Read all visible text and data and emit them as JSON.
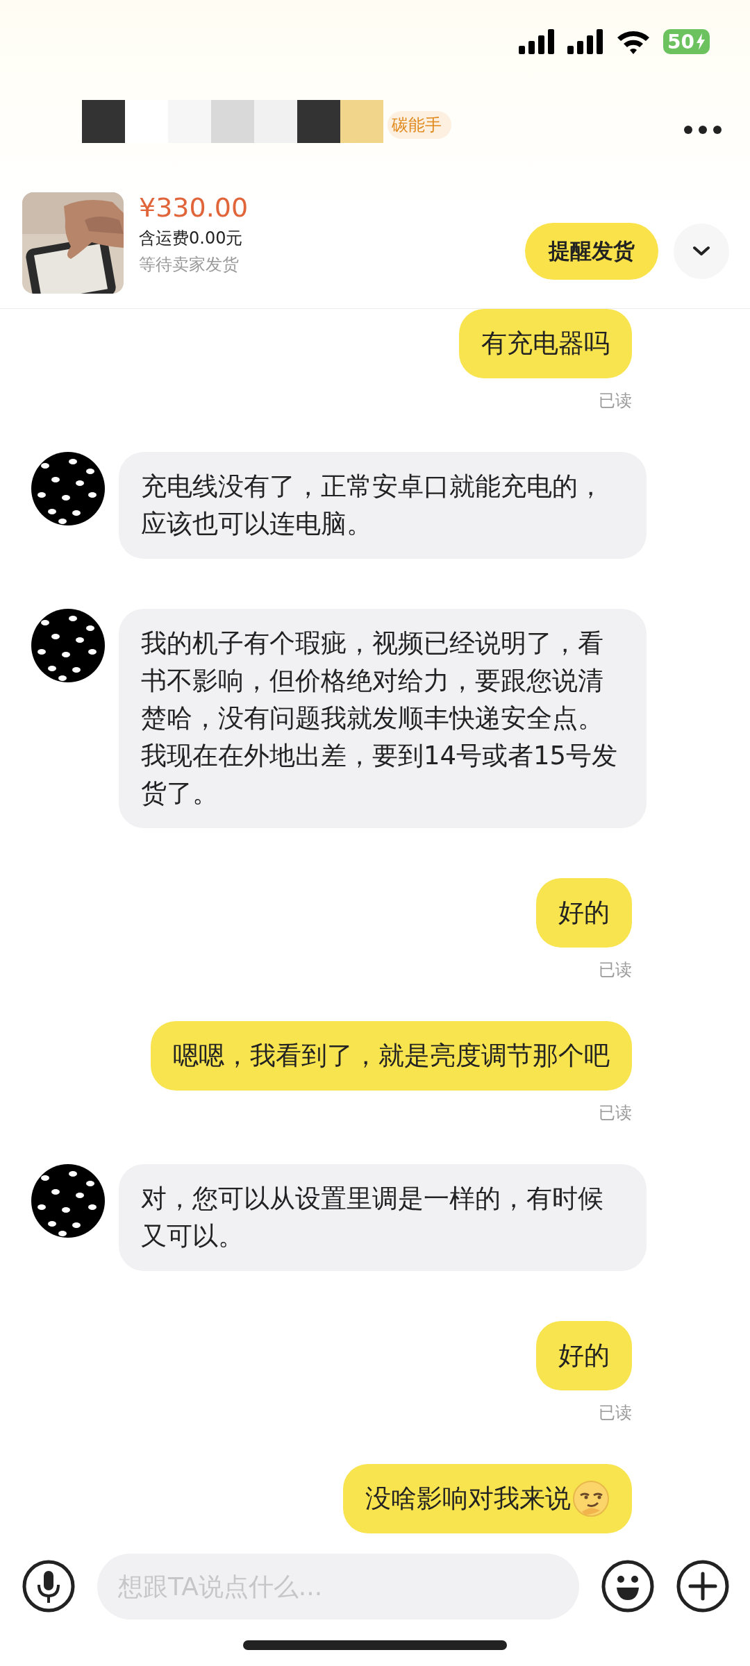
{
  "status_bar": {
    "battery": "50"
  },
  "header": {
    "name_tag": "碳能手"
  },
  "order": {
    "price": "¥330.00",
    "shipping": "含运费0.00元",
    "status": "等待卖家发货",
    "action": "提醒发货"
  },
  "messages": [
    {
      "kind": "sent",
      "text": "有充电器吗",
      "receipt": "已读"
    },
    {
      "kind": "received",
      "text": "充电线没有了，正常安卓口就能充电的，应该也可以连电脑。"
    },
    {
      "kind": "received",
      "text": "我的机子有个瑕疵，视频已经说明了，看书不影响，但价格绝对给力，要跟您说清楚哈，没有问题我就发顺丰快递安全点。我现在在外地出差，要到14号或者15号发货了。"
    },
    {
      "kind": "sent",
      "text": "好的",
      "receipt": "已读"
    },
    {
      "kind": "sent",
      "text": "嗯嗯，我看到了，就是亮度调节那个吧",
      "receipt": "已读"
    },
    {
      "kind": "received",
      "text": "对，您可以从设置里调是一样的，有时候又可以。"
    },
    {
      "kind": "sent",
      "text": "好的",
      "receipt": "已读"
    },
    {
      "kind": "sent",
      "text": "没啥影响对我来说",
      "emoji": true
    }
  ],
  "composer": {
    "placeholder": "想跟TA说点什么..."
  }
}
